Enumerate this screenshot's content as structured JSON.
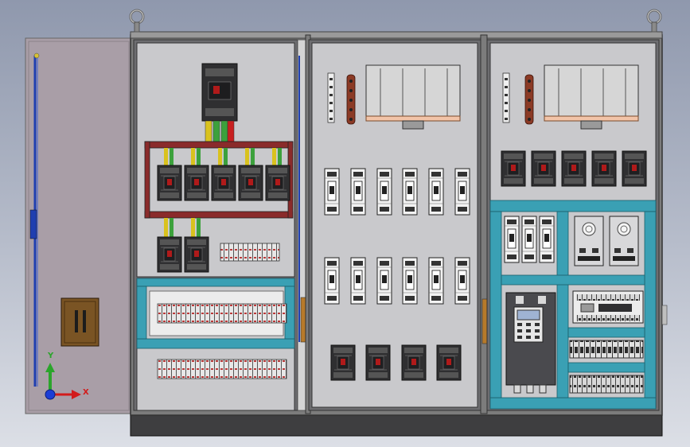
{
  "viewport": {
    "background_top": "#8f98ad",
    "background_bottom": "#dcdfe6"
  },
  "colors": {
    "door": "#a99ea7",
    "cabinet_frame": "#7c7c7c",
    "panel": "#c9c9cc",
    "base_plinth": "#3e3e40",
    "din_rail_teal": "#3aa0b4",
    "busbar_red": "#8a2b2b",
    "breaker_body": "#2f2f31",
    "breaker_toggle": "#b01a1a",
    "terminal_white": "#e7e7e7",
    "hinge_blue": "#1f3fb0",
    "handle_brown": "#7a5424",
    "vfd_body": "#4a4a4e",
    "vfd_screen": "#9fb3d3",
    "power_supply": "#d8d8da",
    "wire_green": "#3ca13c",
    "wire_yellow": "#d9c21e",
    "wire_red": "#c81f1f"
  },
  "axis_triad": {
    "x_label": "X",
    "y_label": "Y",
    "x_color": "#d21b1b",
    "y_color": "#2ba52b",
    "z_color": "#1c3ed6"
  },
  "component_counts": {
    "left_panel_feeder_breakers": 5,
    "left_panel_small_breakers": 2,
    "middle_panel_fuse_holders": 12,
    "middle_panel_breakers": 4,
    "right_panel_breakers": 5,
    "right_panel_fuse_holders": 3,
    "right_panel_power_supplies": 2
  }
}
